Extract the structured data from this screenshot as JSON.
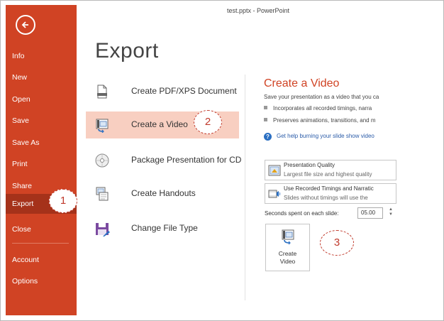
{
  "window": {
    "title": "test.pptx - PowerPoint"
  },
  "sidebar": {
    "items": [
      {
        "label": "Info"
      },
      {
        "label": "New"
      },
      {
        "label": "Open"
      },
      {
        "label": "Save"
      },
      {
        "label": "Save As"
      },
      {
        "label": "Print"
      },
      {
        "label": "Share"
      },
      {
        "label": "Export"
      },
      {
        "label": "Close"
      },
      {
        "label": "Account"
      },
      {
        "label": "Options"
      }
    ],
    "active": "Export",
    "background": "#d04324",
    "active_background": "#a5321a"
  },
  "page": {
    "title": "Export"
  },
  "export_options": [
    {
      "label": "Create PDF/XPS Document",
      "icon": "pdf-document-icon"
    },
    {
      "label": "Create a Video",
      "icon": "video-icon",
      "selected": true
    },
    {
      "label": "Package Presentation for CD",
      "icon": "cd-icon"
    },
    {
      "label": "Create Handouts",
      "icon": "handouts-icon"
    },
    {
      "label": "Change File Type",
      "icon": "file-type-icon"
    }
  ],
  "video_panel": {
    "title": "Create a Video",
    "description": "Save your presentation as a video that you ca",
    "bullets": [
      "Incorporates all recorded timings, narra",
      "Preserves animations, transitions, and m"
    ],
    "help_link": "Get help burning your slide show video",
    "quality_dropdown": {
      "label": "Presentation Quality",
      "sub": "Largest file size and highest quality"
    },
    "timings_dropdown": {
      "label": "Use Recorded Timings and Narratic",
      "sub": "Slides without timings will use the"
    },
    "seconds_label": "Seconds spent on each slide:",
    "seconds_value": "05.00",
    "create_button": {
      "line1": "Create",
      "line2": "Video"
    }
  },
  "callouts": [
    "1",
    "2",
    "3"
  ],
  "colors": {
    "accent": "#d04324",
    "selected_bg": "#f8cfc1",
    "callout": "#c0392b",
    "link": "#2a5ba8"
  }
}
